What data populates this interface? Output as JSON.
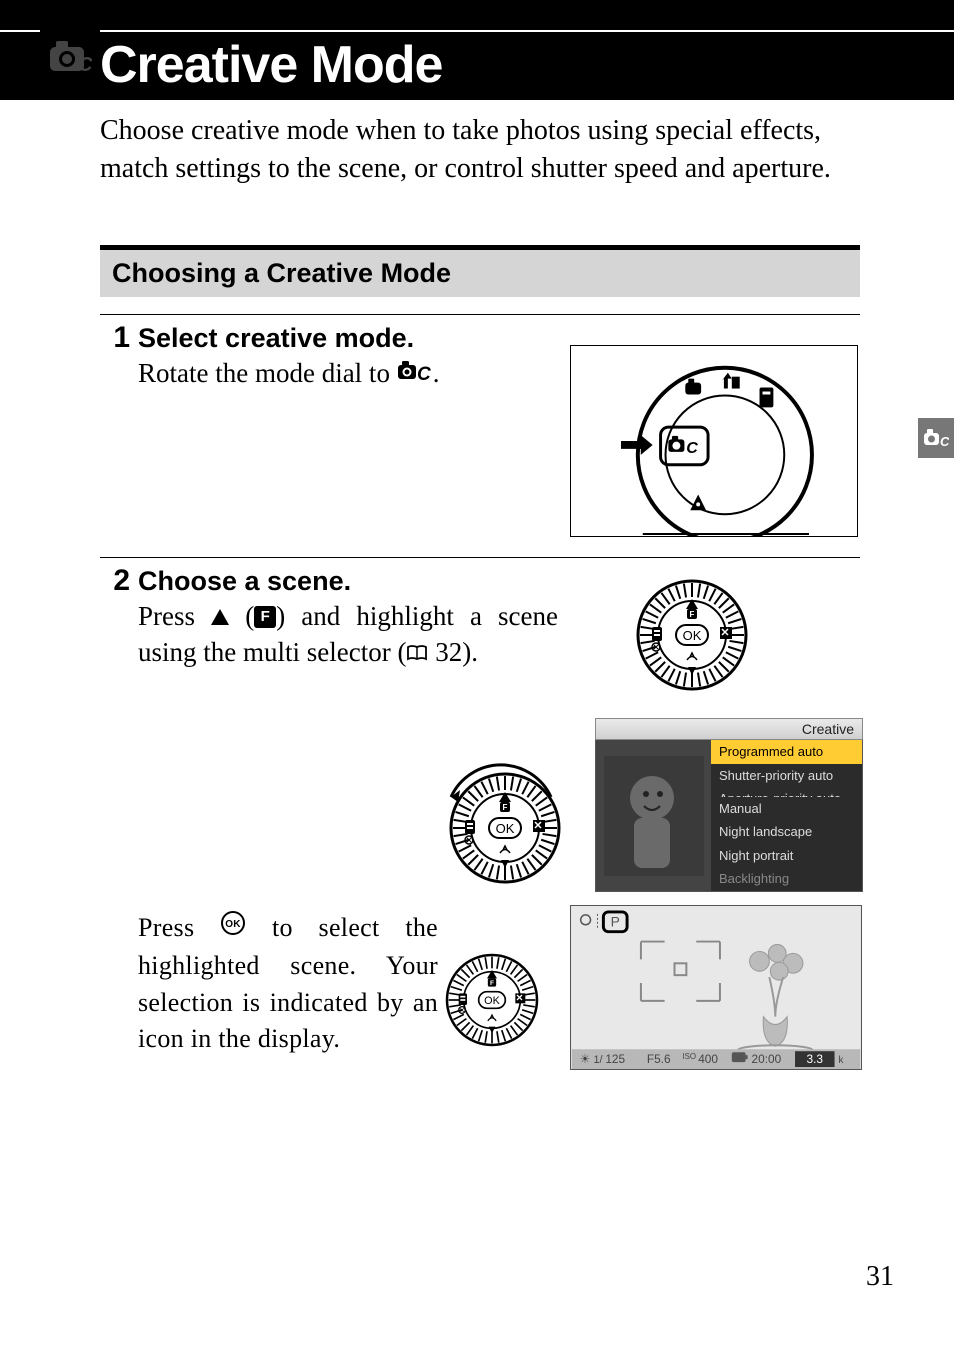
{
  "header": {
    "title": "Creative Mode",
    "icon": "camera-c-icon"
  },
  "intro": "Choose creative mode when to take photos using special effects, match settings to the scene, or control shutter speed and aperture.",
  "section_title": "Choosing a Creative Mode",
  "steps": {
    "s1": {
      "num": "1",
      "title": "Select creative mode.",
      "body_before": "Rotate the mode dial to ",
      "body_after": ".",
      "dial_icon_alt": "creative-mode-symbol"
    },
    "s2": {
      "num": "2",
      "title": "Choose a scene.",
      "body_a": "Press ",
      "body_b": " (",
      "body_c": ") and highlight a scene using the multi selector (",
      "body_d": " 32).",
      "press_ok_a": "Press ",
      "press_ok_b": " to select the highlighted scene. Your selection is indicated by an icon in the display."
    }
  },
  "creative_menu": {
    "header": "Creative",
    "items": [
      "Programmed auto",
      "Shutter-priority auto",
      "Aperture-priority auto",
      "Manual",
      "Night landscape",
      "Night portrait",
      "Backlighting"
    ],
    "selected_index": 0
  },
  "display_mode_letter": "P",
  "display_status_bar": {
    "exp_icon": "exposure-indicator",
    "shutter": "1/125",
    "aperture": "F5.6",
    "iso_label": "ISO",
    "iso": "400",
    "time": "20:00",
    "value": "3.3",
    "suffix": "k"
  },
  "edge_tab_icon": "camera-c-icon",
  "page_number": "31",
  "icons": {
    "ok_label": "OK",
    "f_label": "F",
    "exposure_glyph": "☀"
  }
}
